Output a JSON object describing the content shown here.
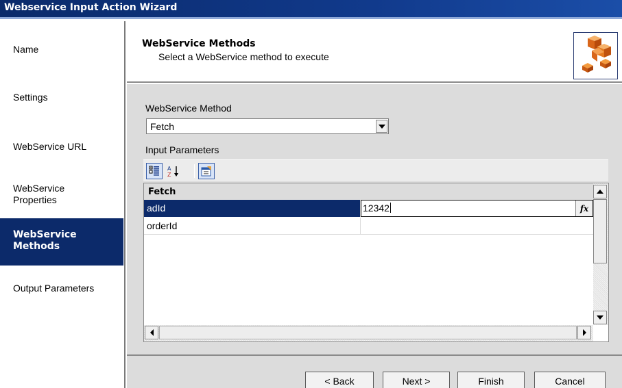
{
  "window": {
    "title": "Webservice Input Action Wizard"
  },
  "sidebar": {
    "items": [
      {
        "label": "Name"
      },
      {
        "label": "Settings"
      },
      {
        "label": "WebService URL"
      },
      {
        "label": "WebService Properties"
      },
      {
        "label": "WebService Methods",
        "active": true
      },
      {
        "label": "Output Parameters"
      }
    ]
  },
  "header": {
    "title": "WebService Methods",
    "subtitle": "Select a WebService method to execute",
    "logo_icon": "orange-cubes-icon"
  },
  "form": {
    "method_label": "WebService Method",
    "method_value": "Fetch",
    "params_label": "Input Parameters"
  },
  "property_grid": {
    "toolbar": [
      "categorized-icon",
      "alphabetical-sort-icon",
      "property-pages-icon"
    ],
    "category": "Fetch",
    "rows": [
      {
        "name": "adId",
        "value": "12342",
        "selected": true
      },
      {
        "name": "orderId",
        "value": ""
      }
    ],
    "fx_label": "fx"
  },
  "footer": {
    "back": "< Back",
    "next": "Next >",
    "finish": "Finish",
    "cancel": "Cancel"
  },
  "colors": {
    "titlebar": "#0c2a6a",
    "selection": "#0c2a6a",
    "panel": "#dcdcdc",
    "accent": "#e8751a"
  }
}
